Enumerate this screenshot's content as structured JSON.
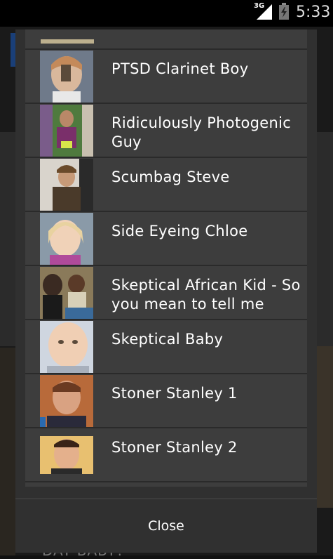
{
  "status_bar": {
    "network_label": "3G",
    "time": "5:33",
    "icons": [
      "signal-icon",
      "battery-charging-icon"
    ]
  },
  "background": {
    "partial_text": "DAT BABY?"
  },
  "dialog": {
    "items": [
      {
        "label": "PTSD Clarinet Boy"
      },
      {
        "label": "Ridiculously Photogenic Guy"
      },
      {
        "label": "Scumbag Steve"
      },
      {
        "label": "Side Eyeing Chloe"
      },
      {
        "label": "Skeptical African Kid - So you mean to tell me"
      },
      {
        "label": "Skeptical Baby"
      },
      {
        "label": "Stoner Stanley 1"
      },
      {
        "label": "Stoner Stanley 2"
      }
    ],
    "close_label": "Close"
  },
  "colors": {
    "dialog_background": "#303030",
    "row_background": "#3d3d3d",
    "divider": "#2a2a2a",
    "text": "#ffffff"
  }
}
